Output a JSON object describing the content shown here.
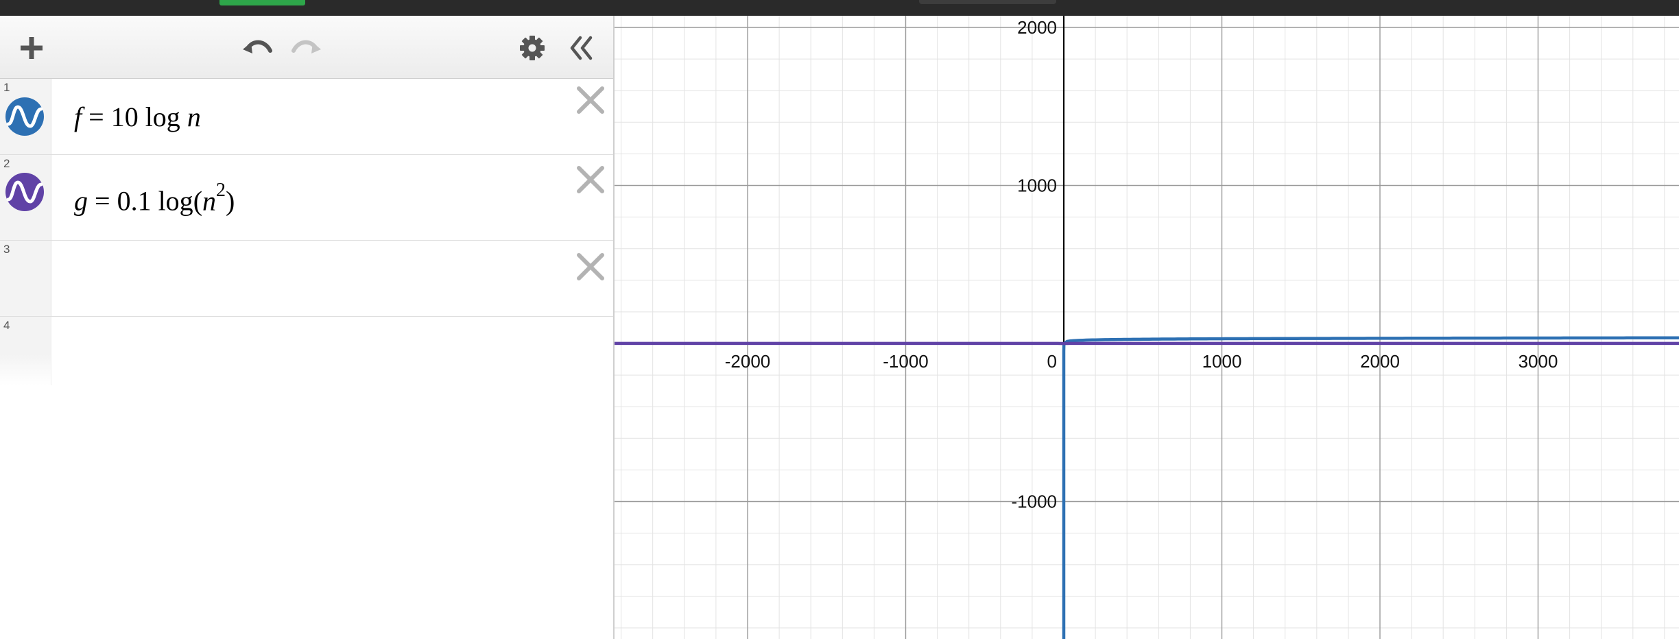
{
  "toolbar": {
    "add": "add-expression",
    "undo": "undo",
    "redo": "redo",
    "settings": "settings",
    "collapse": "collapse-list"
  },
  "expressions": [
    {
      "index": "1",
      "lhs": "f",
      "eq": "=",
      "coef": "10",
      "fn": "log",
      "arg": "n",
      "color": "#2d70b3"
    },
    {
      "index": "2",
      "lhs": "g",
      "eq": "=",
      "coef": "0.1",
      "fn": "log",
      "arg_open": "(",
      "arg": "n",
      "exp": "2",
      "arg_close": ")",
      "color": "#6042a6"
    },
    {
      "index": "3"
    },
    {
      "index": "4"
    }
  ],
  "graph": {
    "x_ticks": [
      "-2000",
      "-1000",
      "0",
      "1000",
      "2000",
      "3000"
    ],
    "y_ticks": [
      "2000",
      "1000",
      "-1000"
    ],
    "x_tick_values": [
      -2000,
      -1000,
      0,
      1000,
      2000,
      3000
    ],
    "y_tick_values": [
      2000,
      1000,
      -1000
    ],
    "curves": [
      {
        "name": "f",
        "expression": "10 log n",
        "color": "#2d70b3"
      },
      {
        "name": "g",
        "expression": "0.1 log (n^2)",
        "color": "#6042a6"
      }
    ]
  }
}
